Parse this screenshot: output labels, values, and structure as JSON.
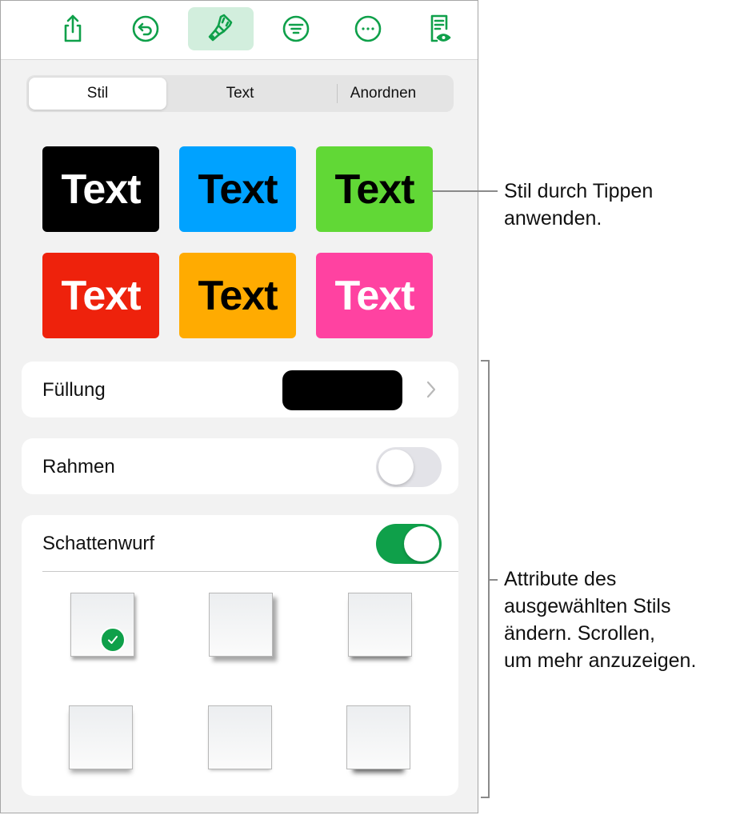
{
  "toolbar": {
    "buttons": [
      {
        "icon": "share-icon",
        "label": "Share"
      },
      {
        "icon": "undo-icon",
        "label": "Undo"
      },
      {
        "icon": "paintbrush-icon",
        "label": "Format",
        "active": true
      },
      {
        "icon": "filter-icon",
        "label": "Organize"
      },
      {
        "icon": "more-icon",
        "label": "More"
      },
      {
        "icon": "document-view-icon",
        "label": "Reading View"
      }
    ],
    "accent_color": "#0fa04a",
    "active_bg": "#d2eedd"
  },
  "segmented_control": {
    "tabs": [
      {
        "label": "Stil",
        "selected": true
      },
      {
        "label": "Text",
        "selected": false
      },
      {
        "label": "Anordnen",
        "selected": false
      }
    ]
  },
  "style_presets": [
    {
      "label": "Text",
      "bg": "#000000",
      "fg": "#ffffff"
    },
    {
      "label": "Text",
      "bg": "#00a2ff",
      "fg": "#000000"
    },
    {
      "label": "Text",
      "bg": "#61d836",
      "fg": "#000000"
    },
    {
      "label": "Text",
      "bg": "#ee220c",
      "fg": "#ffffff"
    },
    {
      "label": "Text",
      "bg": "#ffab01",
      "fg": "#000000"
    },
    {
      "label": "Text",
      "bg": "#ff42a1",
      "fg": "#ffffff"
    }
  ],
  "fill": {
    "label": "Füllung",
    "color": "#000000"
  },
  "border": {
    "label": "Rahmen",
    "enabled": false
  },
  "shadow": {
    "label": "Schattenwurf",
    "enabled": true,
    "options": [
      {
        "name": "shadow-option-1",
        "selected": true
      },
      {
        "name": "shadow-option-2",
        "selected": false
      },
      {
        "name": "shadow-option-3",
        "selected": false
      },
      {
        "name": "shadow-option-4",
        "selected": false
      },
      {
        "name": "shadow-option-5",
        "selected": false
      },
      {
        "name": "shadow-option-6",
        "selected": false
      }
    ]
  },
  "callouts": {
    "top": [
      "Stil durch Tippen",
      "anwenden."
    ],
    "bottom": [
      "Attribute des",
      "ausgewählten Stils",
      "ändern. Scrollen,",
      "um mehr anzuzeigen."
    ]
  }
}
